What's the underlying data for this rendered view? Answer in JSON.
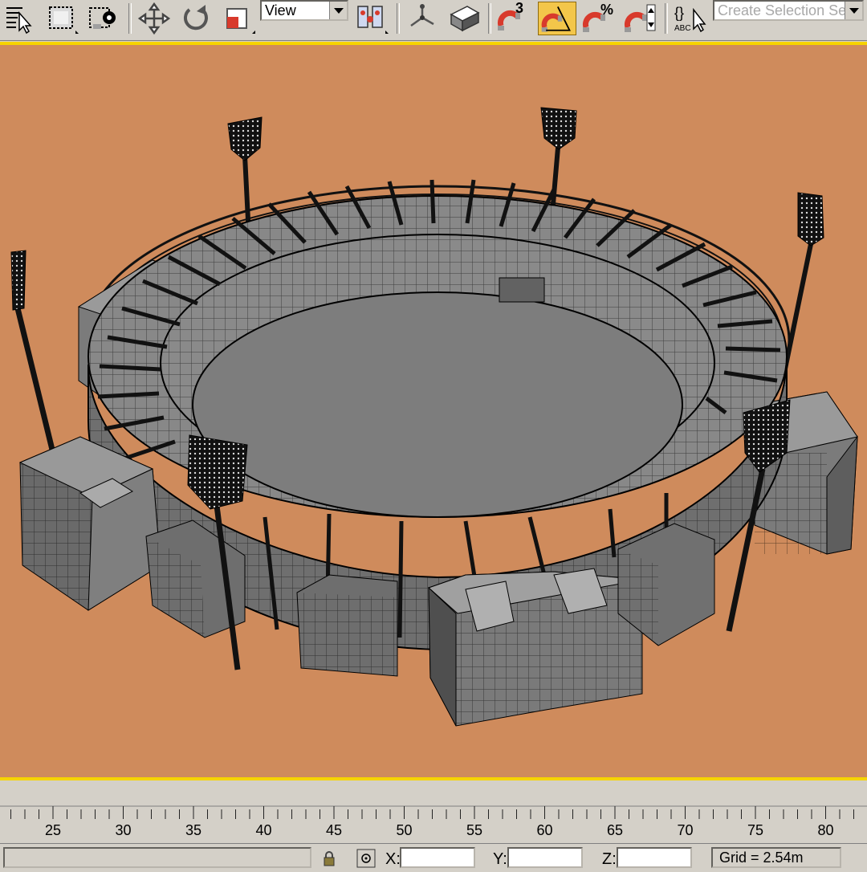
{
  "toolbar": {
    "buttons": [
      {
        "name": "select-by-name-icon"
      },
      {
        "name": "rectangular-selection-region-icon"
      },
      {
        "name": "window-crossing-icon"
      },
      {
        "name": "select-and-move-icon"
      },
      {
        "name": "select-and-rotate-icon"
      },
      {
        "name": "select-and-scale-icon"
      },
      {
        "name": "use-pivot-center-icon"
      },
      {
        "name": "select-and-manipulate-icon"
      },
      {
        "name": "keyboard-shortcut-override-icon"
      },
      {
        "name": "snaps-toggle-icon"
      },
      {
        "name": "angle-snap-toggle-icon",
        "active": true
      },
      {
        "name": "percent-snap-toggle-icon"
      },
      {
        "name": "spinner-snap-toggle-icon"
      },
      {
        "name": "edit-named-selection-sets-icon"
      }
    ],
    "reference_coordinate": "View",
    "snap_dimension": "3",
    "selection_set_placeholder": "Create Selection Set",
    "active_color": "#f3c64a"
  },
  "viewport": {
    "background_color": "#cf8b5c",
    "border_color": "#f6d400",
    "model_color": "#7a7a7a"
  },
  "timeline": {
    "ticks": [
      "25",
      "30",
      "35",
      "40",
      "45",
      "50",
      "55",
      "60",
      "65",
      "70",
      "75",
      "80"
    ]
  },
  "status_bar": {
    "x_label": "X:",
    "y_label": "Y:",
    "z_label": "Z:",
    "x_value": "",
    "y_value": "",
    "z_value": "",
    "grid": "Grid = 2.54m"
  }
}
